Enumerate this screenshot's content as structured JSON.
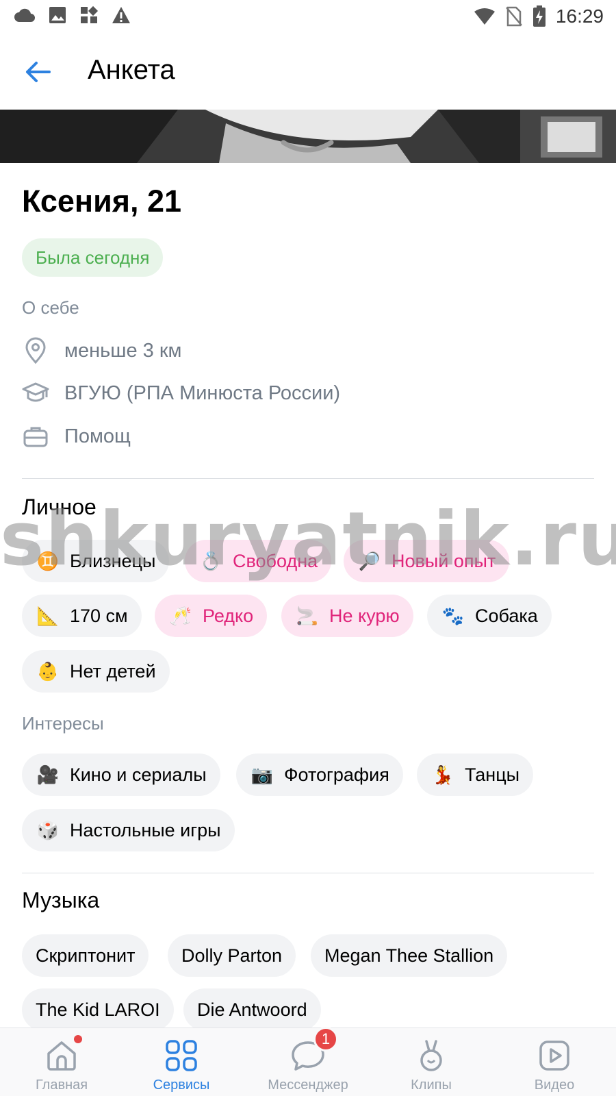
{
  "status_bar": {
    "time": "16:29",
    "left_icons": [
      "cloud-icon",
      "image-icon",
      "widgets-icon",
      "warning-icon"
    ],
    "right_icons": [
      "wifi-icon",
      "no-sim-icon",
      "battery-charging-icon"
    ]
  },
  "app_bar": {
    "title": "Анкета",
    "back_icon": "arrow-left-icon",
    "accent": "#2d81e0"
  },
  "profile": {
    "name_age": "Ксения, 21",
    "online_status": "Была сегодня",
    "about_label": "О себе",
    "info": [
      {
        "icon": "location-pin-icon",
        "text": "меньше 3 км"
      },
      {
        "icon": "graduation-cap-icon",
        "text": "ВГУЮ (РПА Минюста России)"
      },
      {
        "icon": "briefcase-icon",
        "text": "Помощ"
      }
    ]
  },
  "personal": {
    "title": "Личное",
    "chips": [
      {
        "emoji": "♊",
        "label": "Близнецы",
        "highlight": false
      },
      {
        "emoji": "💍",
        "label": "Свободна",
        "highlight": true
      },
      {
        "emoji": "🔎",
        "label": "Новый опыт",
        "highlight": true
      },
      {
        "emoji": "📐",
        "label": "170 см",
        "highlight": false
      },
      {
        "emoji": "🥂",
        "label": "Редко",
        "highlight": true
      },
      {
        "emoji": "🚬",
        "label": "Не курю",
        "highlight": true
      },
      {
        "emoji": "🐾",
        "label": "Собака",
        "highlight": false
      },
      {
        "emoji": "👶",
        "label": "Нет детей",
        "highlight": false
      }
    ]
  },
  "interests": {
    "title": "Интересы",
    "chips": [
      {
        "emoji": "🎥",
        "label": "Кино и сериалы"
      },
      {
        "emoji": "📷",
        "label": "Фотография"
      },
      {
        "emoji": "💃",
        "label": "Танцы"
      },
      {
        "emoji": "🎲",
        "label": "Настольные игры"
      }
    ]
  },
  "music": {
    "title": "Музыка",
    "chips": [
      "Скриптонит",
      "Dolly Parton",
      "Megan Thee Stallion",
      "The Kid LAROI",
      "Die Antwoord"
    ]
  },
  "watermark": "shkuryatnik.ru",
  "tab_bar": {
    "tabs": [
      {
        "label": "Главная",
        "icon": "home-icon",
        "active": false
      },
      {
        "label": "Сервисы",
        "icon": "services-grid-icon",
        "active": true
      },
      {
        "label": "Мессенджер",
        "icon": "chat-bubble-icon",
        "active": false
      },
      {
        "label": "Клипы",
        "icon": "clips-icon",
        "active": false
      },
      {
        "label": "Видео",
        "icon": "video-play-icon",
        "active": false
      }
    ],
    "messenger_badge": "1"
  }
}
